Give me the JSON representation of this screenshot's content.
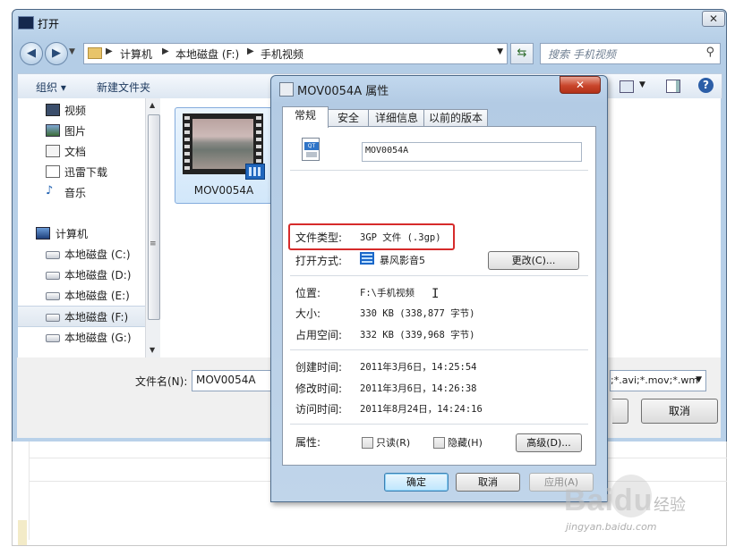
{
  "open_dialog": {
    "title": "打开",
    "breadcrumb": [
      "计算机",
      "本地磁盘 (F:)",
      "手机视频"
    ],
    "search_placeholder": "搜索 手机视频",
    "toolbar": {
      "organize": "组织 ▾",
      "new_folder": "新建文件夹"
    },
    "nav_items": [
      {
        "label": "视频",
        "icon": "video-library-icon"
      },
      {
        "label": "图片",
        "icon": "pictures-library-icon"
      },
      {
        "label": "文档",
        "icon": "documents-library-icon"
      },
      {
        "label": "迅雷下载",
        "icon": "download-folder-icon"
      },
      {
        "label": "音乐",
        "icon": "music-library-icon"
      },
      {
        "label": "计算机",
        "icon": "computer-icon"
      },
      {
        "label": "本地磁盘 (C:)",
        "icon": "system-drive-icon"
      },
      {
        "label": "本地磁盘 (D:)",
        "icon": "drive-icon"
      },
      {
        "label": "本地磁盘 (E:)",
        "icon": "drive-icon"
      },
      {
        "label": "本地磁盘 (F:)",
        "icon": "drive-icon",
        "selected": true
      },
      {
        "label": "本地磁盘 (G:)",
        "icon": "drive-icon"
      }
    ],
    "file": {
      "name": "MOV0054A"
    },
    "filename_label": "文件名(N):",
    "filename_value": "MOV0054A",
    "filter_text": ";*.avi;*.mov;*.wm",
    "cancel": "取消"
  },
  "properties": {
    "title": "MOV0054A 属性",
    "close": "✕",
    "tabs": [
      "常规",
      "安全",
      "详细信息",
      "以前的版本"
    ],
    "name_value": "MOV0054A",
    "file_type_label": "文件类型:",
    "file_type_value": "3GP 文件 (.3gp)",
    "open_with_label": "打开方式:",
    "open_with_value": "暴风影音5",
    "change_button": "更改(C)...",
    "location_label": "位置:",
    "location_value": "F:\\手机视频",
    "size_label": "大小:",
    "size_value": "330 KB (338,877 字节)",
    "disk_size_label": "占用空间:",
    "disk_size_value": "332 KB (339,968 字节)",
    "created_label": "创建时间:",
    "created_value": "2011年3月6日，14:25:54",
    "modified_label": "修改时间:",
    "modified_value": "2011年3月6日，14:26:38",
    "accessed_label": "访问时间:",
    "accessed_value": "2011年8月24日，14:24:16",
    "attributes_label": "属性:",
    "readonly_label": "只读(R)",
    "hidden_label": "隐藏(H)",
    "advanced_button": "高级(D)...",
    "ok_button": "确定",
    "cancel_button": "取消",
    "apply_button": "应用(A)"
  },
  "watermark": {
    "brand": "Bai",
    "brand2": "du",
    "suffix": "经验",
    "url": "jingyan.baidu.com"
  },
  "colors": {
    "highlight": "#d62b2b",
    "title_bar": "#b9d1e9",
    "close_red": "#c9452b"
  }
}
